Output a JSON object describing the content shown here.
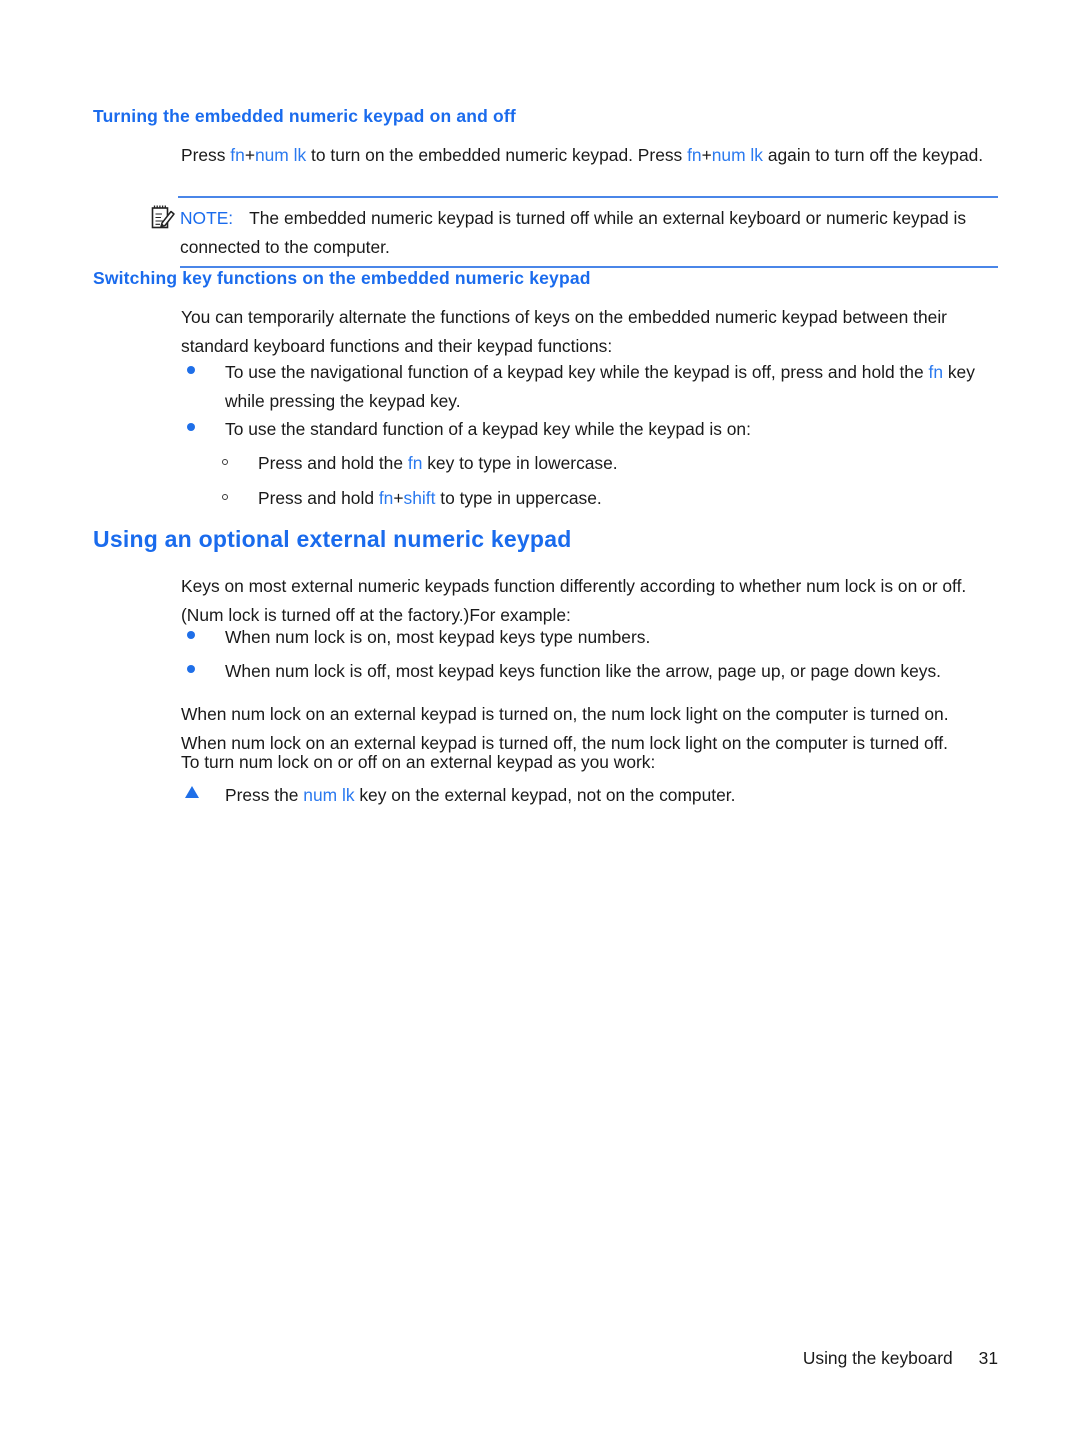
{
  "document": {
    "sections": [
      {
        "id": "turning-keypad",
        "heading": "Turning the embedded numeric keypad on and off",
        "paragraph_1_part_1": "Press ",
        "paragraph_1_kbd_1": "fn",
        "paragraph_1_plus_1": "+",
        "paragraph_1_kbd_2": "num lk",
        "paragraph_1_part_2": " to turn on the embedded numeric keypad. Press ",
        "paragraph_1_kbd_3": "fn",
        "paragraph_1_plus_2": "+",
        "paragraph_1_kbd_4": "num lk",
        "paragraph_1_part_3": " again to turn off the keypad."
      },
      {
        "id": "switching-key-functions",
        "heading": "Switching key functions on the embedded numeric keypad",
        "intro": "You can temporarily alternate the functions of keys on the embedded numeric keypad between their standard keyboard functions and their keypad functions:",
        "bullets": [
          {
            "text_before": "To use the navigational function of a keypad key while the keypad is off, press and hold the ",
            "kbd": "fn",
            "text_after": " key while pressing the keypad key."
          },
          {
            "text_before": "To use the standard function of a keypad key while the keypad is on:",
            "kbd": "",
            "text_after": ""
          }
        ],
        "subbullets": [
          {
            "text_before": "Press and hold the ",
            "kbd": "fn",
            "text_after": " key to type in lowercase."
          },
          {
            "text_before": "Press and hold ",
            "kbd": "fn",
            "plus": "+",
            "kbd2": "shift",
            "text_after": " to type in uppercase."
          }
        ]
      },
      {
        "id": "external-keypad",
        "heading": "Using an optional external numeric keypad",
        "intro": "Keys on most external numeric keypads function differently according to whether num lock is on or off. (Num lock is turned off at the factory.)For example:",
        "bullets": [
          "When num lock is on, most keypad keys type numbers.",
          "When num lock is off, most keypad keys function like the arrow, page up, or page down keys."
        ],
        "paragraph_2": "When num lock on an external keypad is turned on, the num lock light on the computer is turned on. When num lock on an external keypad is turned off, the num lock light on the computer is turned off.",
        "paragraph_3": "To turn num lock on or off on an external keypad as you work:",
        "step": {
          "text_before": "Press the ",
          "kbd": "num lk",
          "text_after": " key on the external keypad, not on the computer."
        }
      }
    ],
    "note": {
      "label": "NOTE:",
      "text": "The embedded numeric keypad is turned off while an external keyboard or numeric keypad is connected to the computer."
    },
    "footer": {
      "running_head": "Using the keyboard",
      "page_number": "31"
    },
    "colors": {
      "heading_blue": "#1a6bed",
      "inline_key_blue": "#2a79ef",
      "bullet_blue": "#1f6fe8",
      "rule_blue": "#4a86e8",
      "body_text": "#1a1a1a"
    }
  }
}
